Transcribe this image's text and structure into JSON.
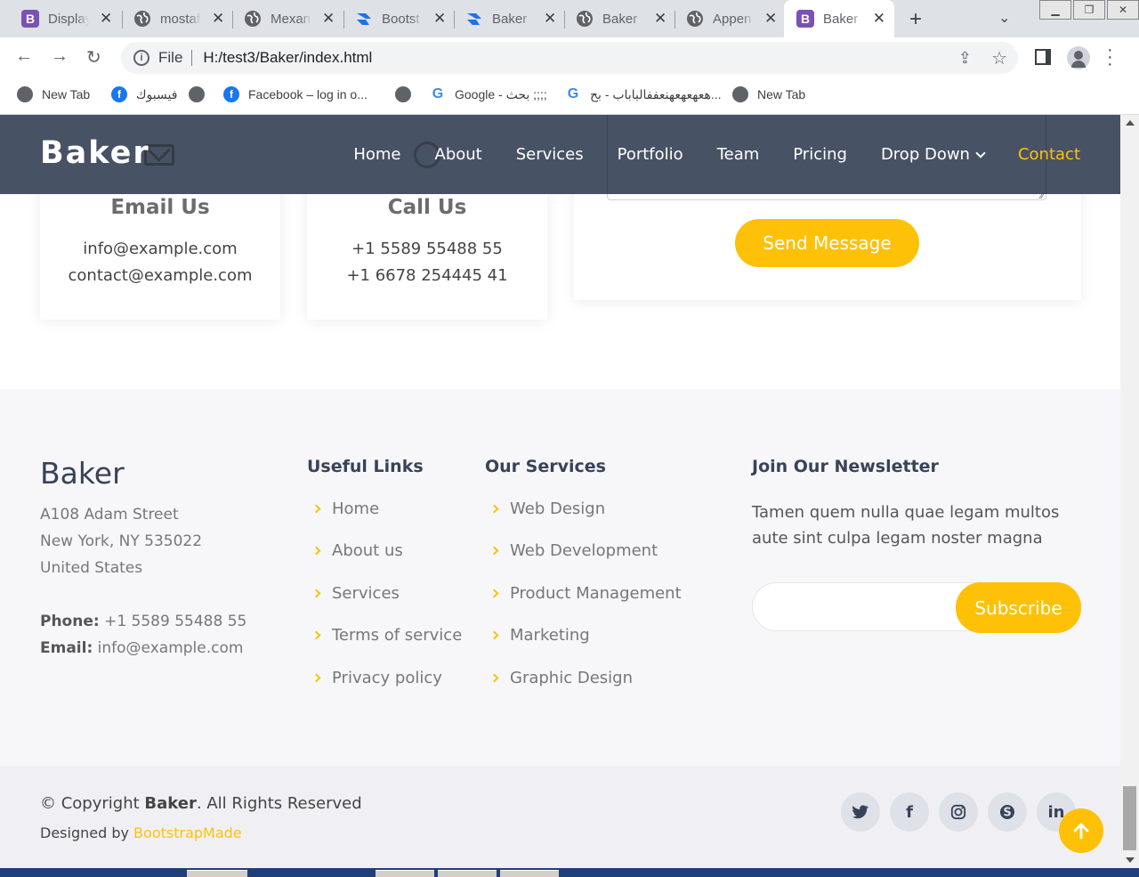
{
  "browser": {
    "tabs": [
      {
        "label": "Display",
        "icon": "bootstrap-icon"
      },
      {
        "label": "mostaf",
        "icon": "globe-icon"
      },
      {
        "label": "Mexan",
        "icon": "globe-icon"
      },
      {
        "label": "Bootst",
        "icon": "wave-icon"
      },
      {
        "label": "Baker",
        "icon": "wave-icon"
      },
      {
        "label": "Baker",
        "icon": "globe-icon"
      },
      {
        "label": "Appen",
        "icon": "globe-icon"
      },
      {
        "label": "Baker",
        "icon": "bootstrap-icon"
      }
    ],
    "omnibox": {
      "scheme_label": "File",
      "url": "H:/test3/Baker/index.html"
    },
    "bookmarks": [
      {
        "label": "New Tab",
        "icon": "globe-icon"
      },
      {
        "label": "فيسبوك",
        "icon": "facebook-icon"
      },
      {
        "label": "",
        "icon": "globe-icon"
      },
      {
        "label": "Facebook – log in o...",
        "icon": "facebook-icon"
      },
      {
        "label": "",
        "icon": "globe-icon"
      },
      {
        "label": "Google - بحث ;;;;",
        "icon": "google-icon"
      },
      {
        "label": "هعهعهعهنعففالباباب - بح...",
        "icon": "google-icon"
      },
      {
        "label": "New Tab",
        "icon": "globe-icon"
      }
    ]
  },
  "header": {
    "logo": "Baker",
    "nav": [
      "Home",
      "About",
      "Services",
      "Portfolio",
      "Team",
      "Pricing",
      "Drop Down",
      "Contact"
    ],
    "active": "Contact"
  },
  "contact": {
    "email": {
      "title": "Email Us",
      "lines": [
        "info@example.com",
        "contact@example.com"
      ]
    },
    "call": {
      "title": "Call Us",
      "lines": [
        "+1 5589 55488 55",
        "+1 6678 254445 41"
      ]
    },
    "send_label": "Send Message"
  },
  "footer": {
    "brand": "Baker",
    "address": [
      "A108 Adam Street",
      "New York, NY 535022",
      "United States"
    ],
    "phone_label": "Phone:",
    "phone": "+1 5589 55488 55",
    "email_label": "Email:",
    "email": "info@example.com",
    "useful_title": "Useful Links",
    "useful_links": [
      "Home",
      "About us",
      "Services",
      "Terms of service",
      "Privacy policy"
    ],
    "services_title": "Our Services",
    "services_links": [
      "Web Design",
      "Web Development",
      "Product Management",
      "Marketing",
      "Graphic Design"
    ],
    "newsletter_title": "Join Our Newsletter",
    "newsletter_text": "Tamen quem nulla quae legam multos aute sint culpa legam noster magna",
    "subscribe_label": "Subscribe",
    "copyright_pre": "© Copyright",
    "copyright_brand": "Baker",
    "copyright_post": ". All Rights Reserved",
    "designed_by": "Designed by",
    "designer": "BootstrapMade",
    "social": [
      "twitter-icon",
      "facebook-icon",
      "instagram-icon",
      "skype-icon",
      "linkedin-icon"
    ]
  },
  "colors": {
    "accent": "#ffc107",
    "header_bg": "#384358",
    "footer_bg": "#f7f7fa"
  }
}
